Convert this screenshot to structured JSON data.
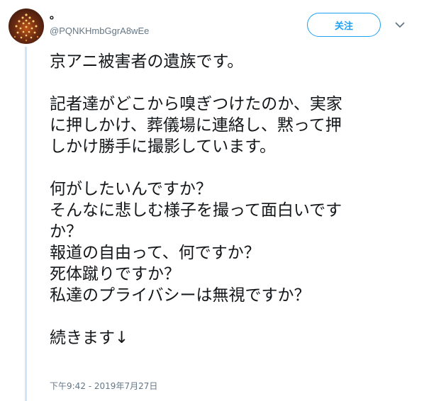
{
  "user": {
    "display_name": "。",
    "handle": "@PQNKHmbGgrA8wEe"
  },
  "follow_button": {
    "label": "关注"
  },
  "icons": {
    "menu": "chevron-down-icon",
    "avatar": "string-lights-avatar"
  },
  "colors": {
    "accent": "#1da1f2",
    "thread_line": "#cde6fb",
    "secondary_text": "#657786"
  },
  "tweet": {
    "lines": [
      "京アニ被害者の遺族です。",
      "",
      "記者達がどこから嗅ぎつけたのか、実家",
      "に押しかけ、葬儀場に連絡し、黙って押",
      "しかけ勝手に撮影しています。",
      "",
      "何がしたいんですか？",
      "そんなに悲しむ様子を撮って面白いです",
      "か？",
      "報道の自由って、何ですか？",
      "死体蹴りですか？",
      "私達のプライバシーは無視ですか？",
      "",
      "続きます↓"
    ],
    "timestamp": "下午9:42 - 2019年7月27日"
  }
}
